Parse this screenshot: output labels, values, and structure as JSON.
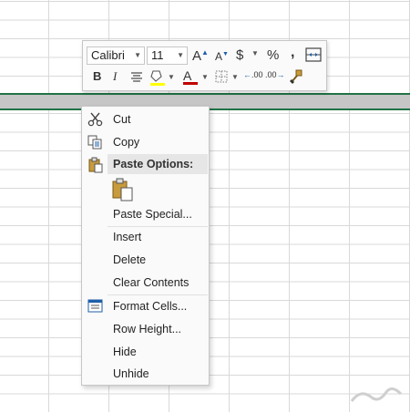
{
  "spreadsheet": {
    "grid": "worksheet-cells",
    "selected_row_color": "#c6c6c6",
    "selection_border_color": "#217346"
  },
  "mini_toolbar": {
    "font_name": "Calibri",
    "font_size": "11",
    "bold_label": "B",
    "italic_label": "I",
    "currency_label": "$",
    "percent_label": "%",
    "comma_label": ",",
    "increase_decimal_label": ".00",
    "decrease_decimal_label": ".00",
    "font_color_label": "A",
    "grow_font_label": "A",
    "shrink_font_label": "A",
    "highlight_color": "#ffff00",
    "font_color": "#c00000"
  },
  "context_menu": {
    "items": [
      {
        "label": "Cut",
        "icon": "scissors-icon"
      },
      {
        "label": "Copy",
        "icon": "copy-icon"
      },
      {
        "label": "Paste Options:",
        "icon": "paste-icon"
      },
      {
        "label": "Paste Special...",
        "icon": ""
      },
      {
        "label": "Insert",
        "icon": ""
      },
      {
        "label": "Delete",
        "icon": ""
      },
      {
        "label": "Clear Contents",
        "icon": ""
      },
      {
        "label": "Format Cells...",
        "icon": "format-cells-icon"
      },
      {
        "label": "Row Height...",
        "icon": ""
      },
      {
        "label": "Hide",
        "icon": ""
      },
      {
        "label": "Unhide",
        "icon": ""
      }
    ]
  }
}
